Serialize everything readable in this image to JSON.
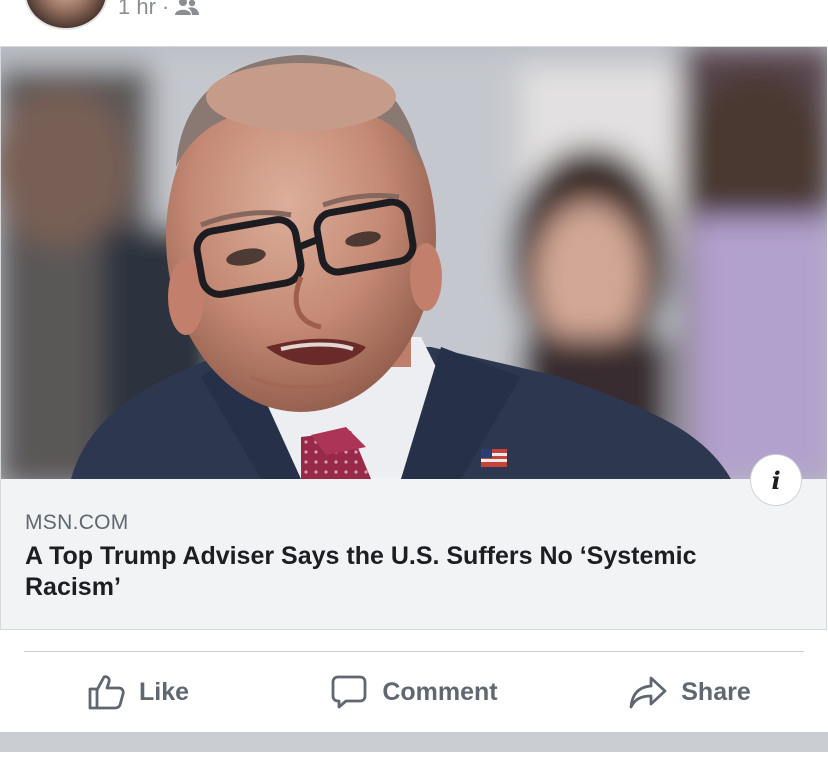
{
  "post": {
    "time": "1 hr",
    "separator": "·",
    "audience_icon": "friends-icon"
  },
  "link_card": {
    "domain": "MSN.COM",
    "headline": "A Top Trump Adviser Says the U.S. Suffers No ‘Systemic Racism’",
    "info_label": "i"
  },
  "actions": {
    "like": "Like",
    "comment": "Comment",
    "share": "Share"
  },
  "colors": {
    "muted_text": "#606770",
    "headline_text": "#1c1e21",
    "card_background": "#f2f3f5",
    "divider": "#ced0d4"
  }
}
